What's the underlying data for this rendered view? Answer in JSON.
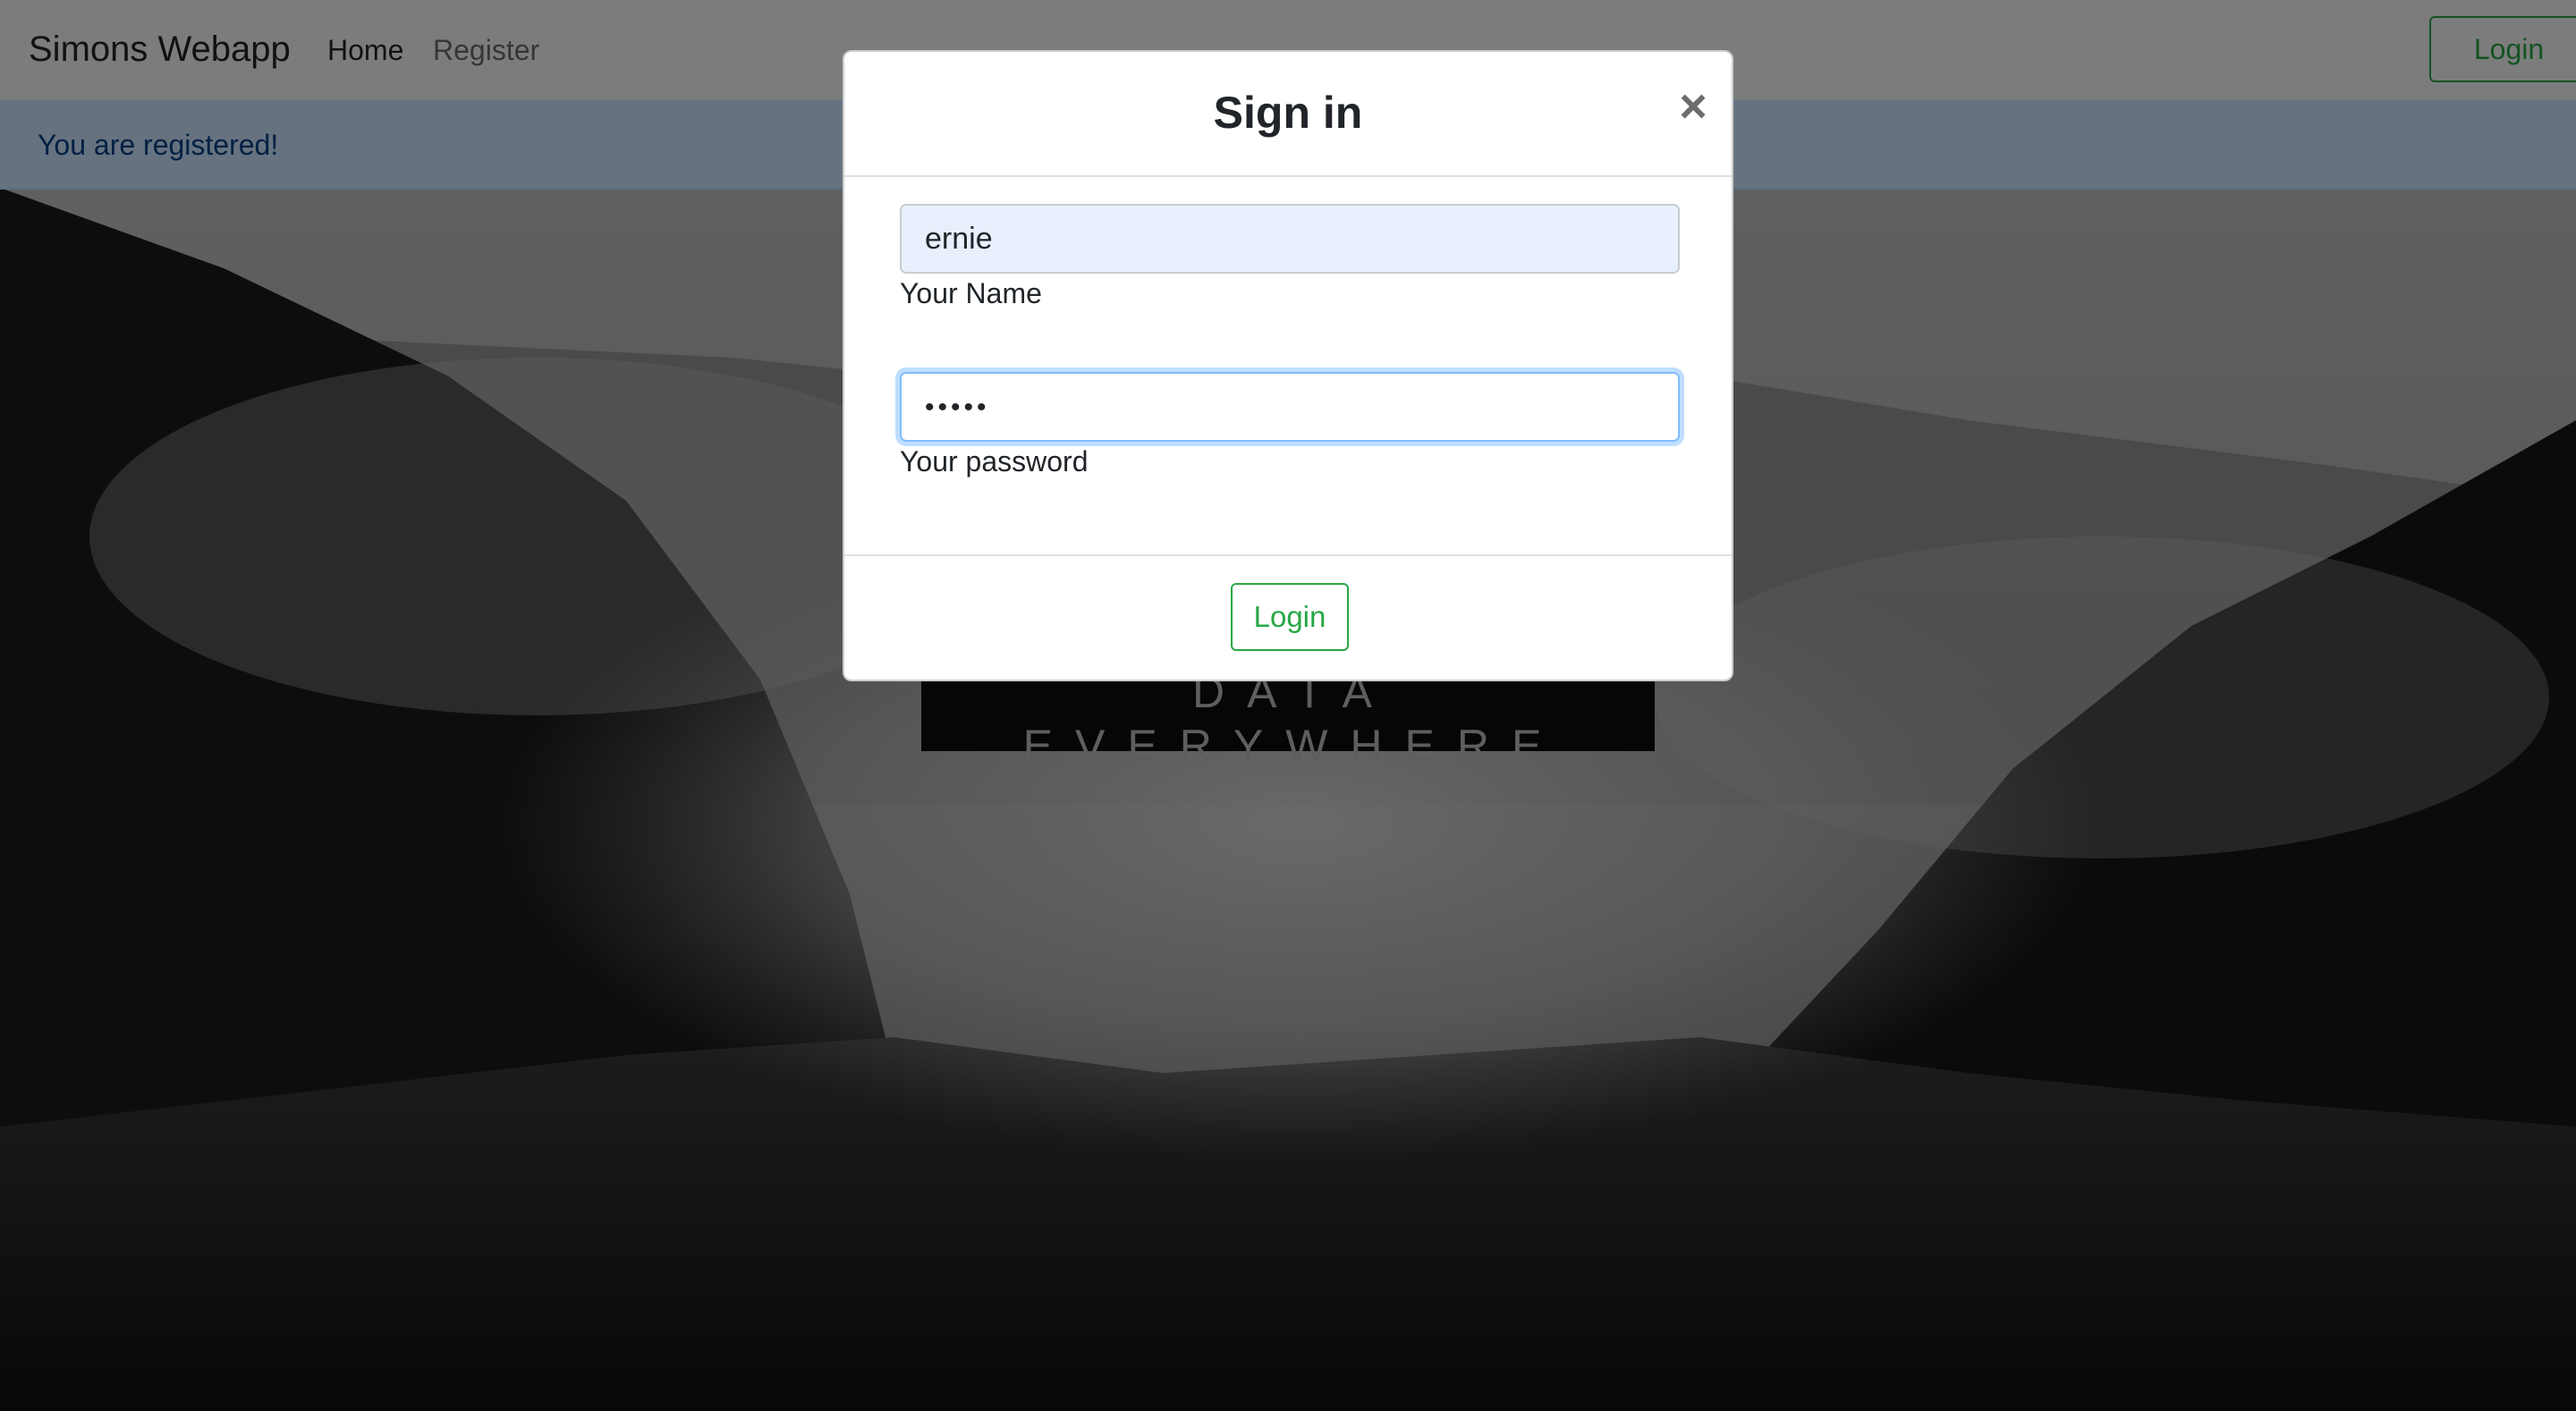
{
  "navbar": {
    "brand": "Simons Webapp",
    "links": [
      "Home",
      "Register"
    ],
    "login_label": "Login"
  },
  "alert": {
    "message": "You are registered!"
  },
  "hero": {
    "tagline": "DATA EVERYWHERE"
  },
  "modal": {
    "title": "Sign in",
    "close_symbol": "×",
    "name_field": {
      "value": "ernie",
      "label": "Your Name"
    },
    "password_field": {
      "value": "•••••",
      "label": "Your password"
    },
    "login_label": "Login"
  },
  "colors": {
    "accent_green": "#28a745",
    "alert_bg": "#cce5ff",
    "alert_text": "#004085",
    "focus_ring": "#80bdff"
  }
}
